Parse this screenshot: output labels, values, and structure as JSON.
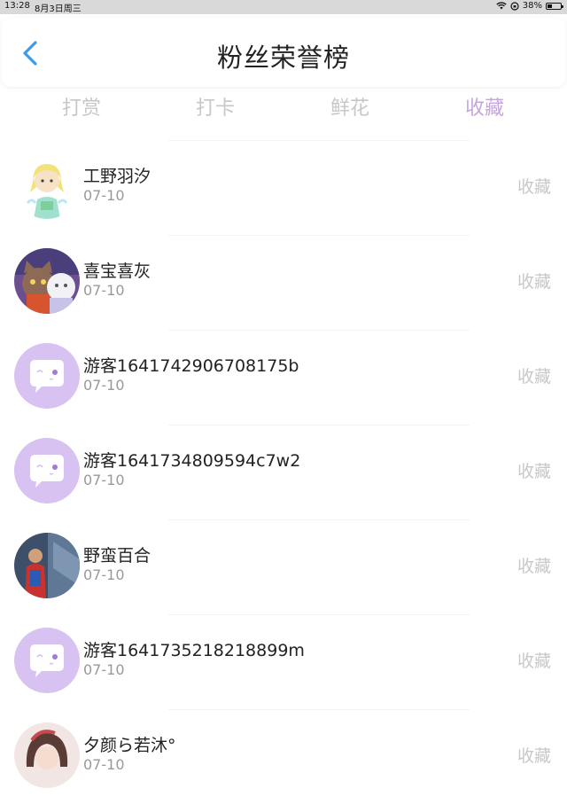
{
  "status_bar": {
    "time": "13:28",
    "date": "8月3日周三",
    "battery": "38%",
    "battery_level": 0.38
  },
  "header": {
    "title": "粉丝荣誉榜",
    "back_icon": "chevron-left-icon",
    "accent": "#3d9be9"
  },
  "tabs": [
    {
      "label": "打赏",
      "active": false
    },
    {
      "label": "打卡",
      "active": false
    },
    {
      "label": "鲜花",
      "active": false
    },
    {
      "label": "收藏",
      "active": true
    }
  ],
  "colors": {
    "active_tab": "#c5a6df",
    "inactive_tab": "#c7c7c7",
    "guest_avatar_bg": "#d7c2f2"
  },
  "fans": [
    {
      "name": "工野羽汐",
      "date": "07-10",
      "action": "收藏",
      "avatar": "anime-girl-avatar"
    },
    {
      "name": "喜宝喜灰",
      "date": "07-10",
      "action": "收藏",
      "avatar": "cat-bear-avatar"
    },
    {
      "name": "游客1641742906708175b",
      "date": "07-10",
      "action": "收藏",
      "avatar": "guest-chat-avatar"
    },
    {
      "name": "游客1641734809594c7w2",
      "date": "07-10",
      "action": "收藏",
      "avatar": "guest-chat-avatar"
    },
    {
      "name": "野蛮百合",
      "date": "07-10",
      "action": "收藏",
      "avatar": "photo-person-avatar"
    },
    {
      "name": "游客1641735218218899m",
      "date": "07-10",
      "action": "收藏",
      "avatar": "guest-chat-avatar"
    },
    {
      "name": "夕颜ら若沐°",
      "date": "07-10",
      "action": "收藏",
      "avatar": "portrait-avatar"
    }
  ]
}
